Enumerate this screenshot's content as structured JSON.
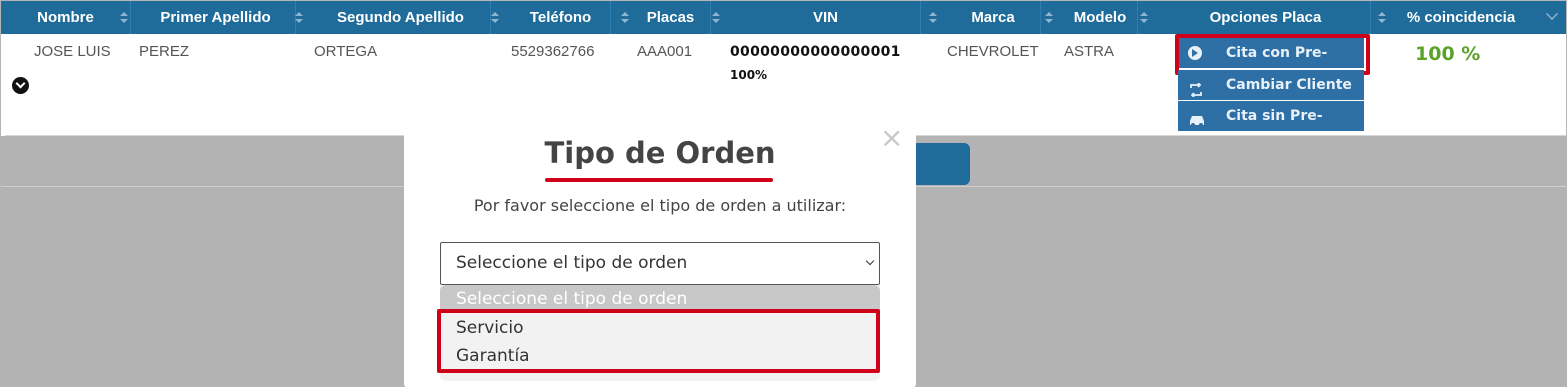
{
  "table": {
    "columns": [
      {
        "label": "Nombre"
      },
      {
        "label": "Primer Apellido"
      },
      {
        "label": "Segundo Apellido"
      },
      {
        "label": "Teléfono"
      },
      {
        "label": "Placas"
      },
      {
        "label": "VIN"
      },
      {
        "label": "Marca"
      },
      {
        "label": "Modelo"
      },
      {
        "label": "Opciones Placa"
      },
      {
        "label": "% coincidencia"
      }
    ],
    "row": {
      "nombre": "JOSE LUIS",
      "primer_apellido": "PEREZ",
      "segundo_apellido": "ORTEGA",
      "telefono": "5529362766",
      "placas": "AAA001",
      "vin": "00000000000000001",
      "vin_match": "100%",
      "marca": "CHEVROLET",
      "modelo": "ASTRA",
      "coincidencia": "100 %"
    },
    "options": {
      "cita_con": "Cita con Pre-orden",
      "cambiar": "Cambiar Cliente",
      "cita_sin": "Cita sin Pre-orden"
    }
  },
  "modal": {
    "title": "Tipo de Orden",
    "message": "Por favor seleccione el tipo de orden a utilizar:",
    "select_value": "Seleccione el tipo de orden",
    "options": [
      "Seleccione el tipo de orden",
      "Servicio",
      "Garantía"
    ],
    "close": "×"
  },
  "colors": {
    "header_bg": "#1f6b9a",
    "button_bg": "#2e6fa6",
    "highlight": "#d0021b",
    "match_green": "#5aa22a"
  }
}
